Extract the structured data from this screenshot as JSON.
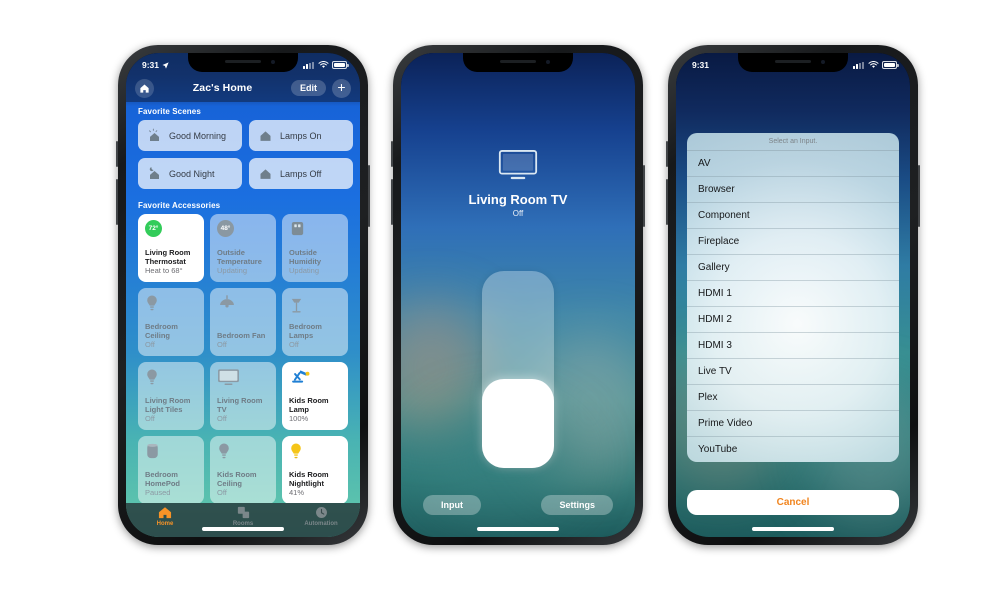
{
  "phone1": {
    "status_bar": {
      "time": "9:31",
      "location_icon": "location-arrow-icon",
      "wifi_icon": "wifi-icon",
      "battery_icon": "battery-icon"
    },
    "nav": {
      "home_icon": "house-icon",
      "title": "Zac's Home",
      "edit_label": "Edit",
      "add_label": "+"
    },
    "scenes_section_label": "Favorite Scenes",
    "scenes": [
      {
        "label": "Good Morning",
        "icon": "house-sun-icon"
      },
      {
        "label": "Lamps On",
        "icon": "house-icon"
      },
      {
        "label": "Good Night",
        "icon": "house-moon-icon"
      },
      {
        "label": "Lamps Off",
        "icon": "house-icon"
      }
    ],
    "accessories_section_label": "Favorite Accessories",
    "accessories": [
      {
        "name": "Living Room Thermostat",
        "status": "Heat to 68°",
        "icon": "thermostat-badge",
        "badge": "72°",
        "on": true
      },
      {
        "name": "Outside Temperature",
        "status": "Updating",
        "icon": "temperature-badge",
        "badge": "48°",
        "on": false
      },
      {
        "name": "Outside Humidity",
        "status": "Updating",
        "icon": "humidity-sensor-icon",
        "on": false
      },
      {
        "name": "Bedroom Ceiling",
        "status": "Off",
        "icon": "bulb-icon",
        "on": false
      },
      {
        "name": "Bedroom Fan",
        "status": "Off",
        "icon": "ceiling-fan-icon",
        "on": false
      },
      {
        "name": "Bedroom Lamps",
        "status": "Off",
        "icon": "floor-lamp-icon",
        "on": false
      },
      {
        "name": "Living Room Light Tiles",
        "status": "Off",
        "icon": "bulb-icon",
        "on": false
      },
      {
        "name": "Living Room TV",
        "status": "Off",
        "icon": "tv-icon",
        "on": false
      },
      {
        "name": "Kids Room Lamp",
        "status": "100%",
        "icon": "desk-lamp-icon",
        "on": true
      },
      {
        "name": "Bedroom HomePod",
        "status": "Paused",
        "icon": "homepod-icon",
        "on": false
      },
      {
        "name": "Kids Room Ceiling",
        "status": "Off",
        "icon": "bulb-icon",
        "on": false
      },
      {
        "name": "Kids Room Nightlight",
        "status": "41%",
        "icon": "bulb-on-icon",
        "on": true
      }
    ],
    "tabs": [
      {
        "label": "Home",
        "icon": "house-icon",
        "active": true
      },
      {
        "label": "Rooms",
        "icon": "rooms-icon",
        "active": false
      },
      {
        "label": "Automation",
        "icon": "automation-clock-icon",
        "active": false
      }
    ]
  },
  "phone2": {
    "device_icon": "tv-icon",
    "title": "Living Room TV",
    "status": "Off",
    "slider_value_percent": 45,
    "buttons": {
      "input": "Input",
      "settings": "Settings"
    }
  },
  "phone3": {
    "status_bar": {
      "time": "9:31",
      "wifi_icon": "wifi-icon",
      "battery_icon": "battery-icon"
    },
    "sheet_header": "Select an Input.",
    "inputs": [
      "AV",
      "Browser",
      "Component",
      "Fireplace",
      "Gallery",
      "HDMI 1",
      "HDMI 2",
      "HDMI 3",
      "Live TV",
      "Plex",
      "Prime Video",
      "YouTube"
    ],
    "cancel_label": "Cancel"
  },
  "colors": {
    "accent_orange": "#f1851f",
    "home_blue": "#1b6fe0",
    "badge_green": "#33cc5a",
    "lamp_yellow": "#f5c518"
  }
}
